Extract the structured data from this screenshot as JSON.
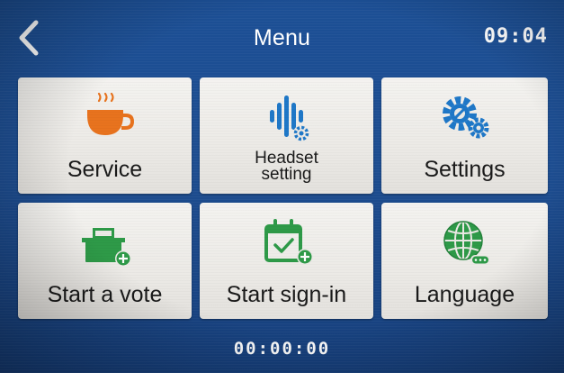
{
  "header": {
    "back_icon": "chevron-left-icon",
    "title": "Menu",
    "clock": "09:04"
  },
  "tiles": [
    {
      "label": "Service",
      "icon": "coffee-cup-icon",
      "icon_color": "#e8731e"
    },
    {
      "label_lines": [
        "Headset",
        "setting"
      ],
      "icon": "headset-waveform-icon",
      "icon_color": "#1f78c8"
    },
    {
      "label": "Settings",
      "icon": "gears-icon",
      "icon_color": "#1f78c8"
    },
    {
      "label": "Start a vote",
      "icon": "ballot-box-icon",
      "icon_color": "#2e9a48"
    },
    {
      "label": "Start sign-in",
      "icon": "calendar-check-icon",
      "icon_color": "#2e9a48"
    },
    {
      "label": "Language",
      "icon": "globe-icon",
      "icon_color": "#2e9a48"
    }
  ],
  "footer": {
    "timer": "00:00:00"
  },
  "colors": {
    "background": "#1c4f95",
    "tile": "#efeeea",
    "orange": "#e8731e",
    "blue": "#1f78c8",
    "green": "#2e9a48"
  }
}
